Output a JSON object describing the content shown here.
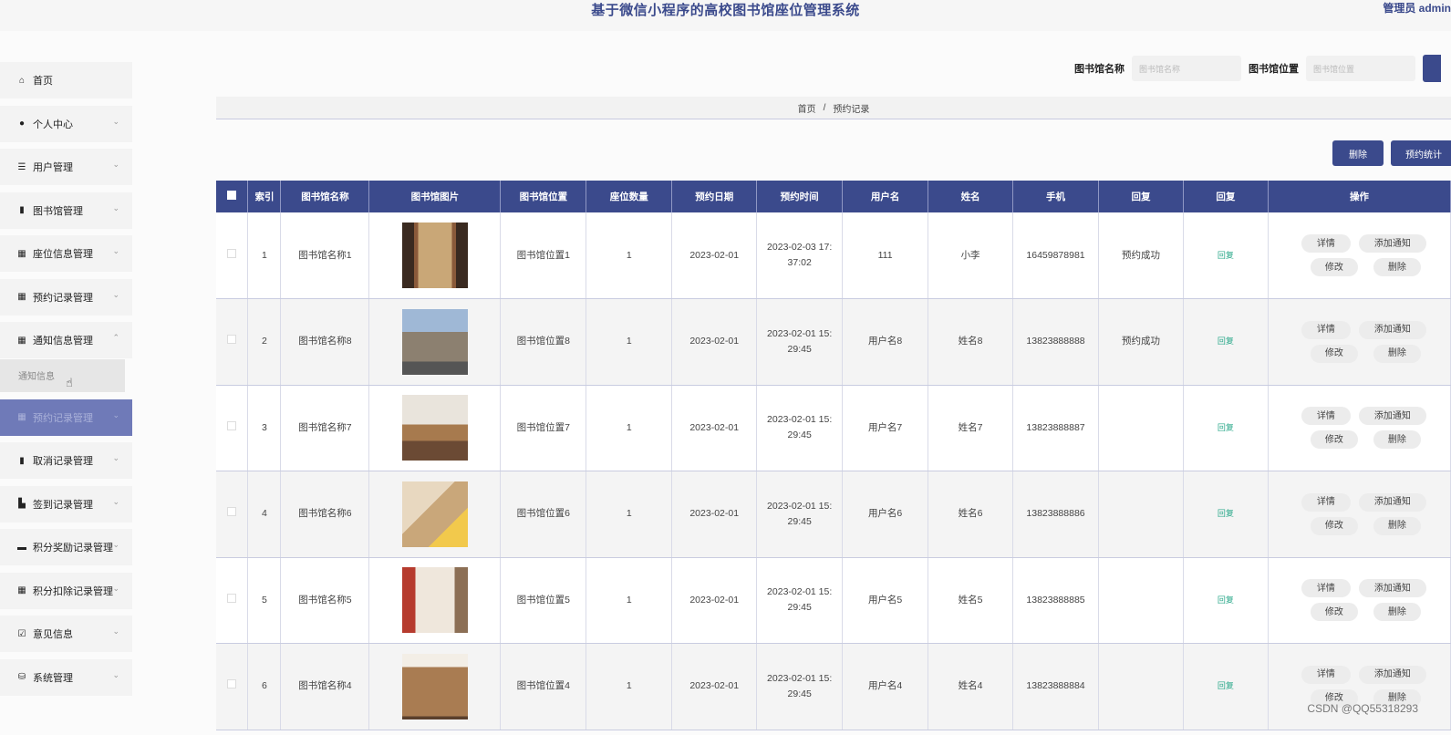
{
  "header": {
    "title": "基于微信小程序的高校图书馆座位管理系统",
    "admin": "管理员 admin"
  },
  "sidebar": {
    "items": [
      {
        "label": "首页",
        "icon": "home-icon",
        "glyph": "⌂",
        "chevron": ""
      },
      {
        "label": "个人中心",
        "icon": "user-icon",
        "glyph": "●",
        "chevron": "⌄"
      },
      {
        "label": "用户管理",
        "icon": "list-icon",
        "glyph": "☰",
        "chevron": "⌄"
      },
      {
        "label": "图书馆管理",
        "icon": "book-icon",
        "glyph": "▮",
        "chevron": "⌄"
      },
      {
        "label": "座位信息管理",
        "icon": "grid-icon",
        "glyph": "▦",
        "chevron": "⌄"
      },
      {
        "label": "预约记录管理",
        "icon": "grid-icon",
        "glyph": "▦",
        "chevron": "⌄"
      },
      {
        "label": "通知信息管理",
        "icon": "grid-icon",
        "glyph": "▦",
        "chevron": "⌃"
      },
      {
        "label": "预约记录管理",
        "icon": "grid-icon",
        "glyph": "▦",
        "chevron": "⌄",
        "active": true
      },
      {
        "label": "取消记录管理",
        "icon": "bar-chart-icon",
        "glyph": "▮",
        "chevron": "⌄"
      },
      {
        "label": "签到记录管理",
        "icon": "chart-icon",
        "glyph": "▙",
        "chevron": "⌄"
      },
      {
        "label": "积分奖励记录管理",
        "icon": "bag-icon",
        "glyph": "▬",
        "chevron": "⌄"
      },
      {
        "label": "积分扣除记录管理",
        "icon": "grid-icon",
        "glyph": "▦",
        "chevron": "⌄"
      },
      {
        "label": "意见信息",
        "icon": "checkbox-icon",
        "glyph": "☑",
        "chevron": "⌄"
      },
      {
        "label": "系统管理",
        "icon": "database-icon",
        "glyph": "⛁",
        "chevron": "⌄"
      }
    ],
    "submenu": {
      "label": "通知信息"
    }
  },
  "search": {
    "name_label": "图书馆名称",
    "name_placeholder": "图书馆名称",
    "location_label": "图书馆位置",
    "location_placeholder": "图书馆位置"
  },
  "breadcrumb": {
    "home": "首页",
    "sep": "/",
    "current": "预约记录"
  },
  "actions": {
    "delete": "删除",
    "export": "预约统计"
  },
  "table": {
    "headers": [
      "索引",
      "图书馆名称",
      "图书馆图片",
      "图书馆位置",
      "座位数量",
      "预约日期",
      "预约时间",
      "用户名",
      "姓名",
      "手机",
      "回复",
      "回复",
      "操作"
    ],
    "rows": [
      {
        "idx": "1",
        "name": "图书馆名称1",
        "location": "图书馆位置1",
        "seats": "1",
        "date": "2023-02-01",
        "time1": "2023-02-03 17:",
        "time2": "37:02",
        "user": "111",
        "realname": "小李",
        "phone": "16459878981",
        "status": "预约成功",
        "reply": "回复"
      },
      {
        "idx": "2",
        "name": "图书馆名称8",
        "location": "图书馆位置8",
        "seats": "1",
        "date": "2023-02-01",
        "time1": "2023-02-01 15:",
        "time2": "29:45",
        "user": "用户名8",
        "realname": "姓名8",
        "phone": "13823888888",
        "status": "预约成功",
        "reply": "回复"
      },
      {
        "idx": "3",
        "name": "图书馆名称7",
        "location": "图书馆位置7",
        "seats": "1",
        "date": "2023-02-01",
        "time1": "2023-02-01 15:",
        "time2": "29:45",
        "user": "用户名7",
        "realname": "姓名7",
        "phone": "13823888887",
        "status": "",
        "reply": "回复"
      },
      {
        "idx": "4",
        "name": "图书馆名称6",
        "location": "图书馆位置6",
        "seats": "1",
        "date": "2023-02-01",
        "time1": "2023-02-01 15:",
        "time2": "29:45",
        "user": "用户名6",
        "realname": "姓名6",
        "phone": "13823888886",
        "status": "",
        "reply": "回复"
      },
      {
        "idx": "5",
        "name": "图书馆名称5",
        "location": "图书馆位置5",
        "seats": "1",
        "date": "2023-02-01",
        "time1": "2023-02-01 15:",
        "time2": "29:45",
        "user": "用户名5",
        "realname": "姓名5",
        "phone": "13823888885",
        "status": "",
        "reply": "回复"
      },
      {
        "idx": "6",
        "name": "图书馆名称4",
        "location": "图书馆位置4",
        "seats": "1",
        "date": "2023-02-01",
        "time1": "2023-02-01 15:",
        "time2": "29:45",
        "user": "用户名4",
        "realname": "姓名4",
        "phone": "13823888884",
        "status": "",
        "reply": "回复"
      }
    ],
    "ops": {
      "detail": "详情",
      "notify": "添加通知",
      "edit": "修改",
      "delete": "删除"
    }
  },
  "watermark": "CSDN @QQ55318293",
  "colors": {
    "primary": "#3b4a8c",
    "active_menu": "#6f7ab8",
    "reply": "#2aa88a"
  }
}
